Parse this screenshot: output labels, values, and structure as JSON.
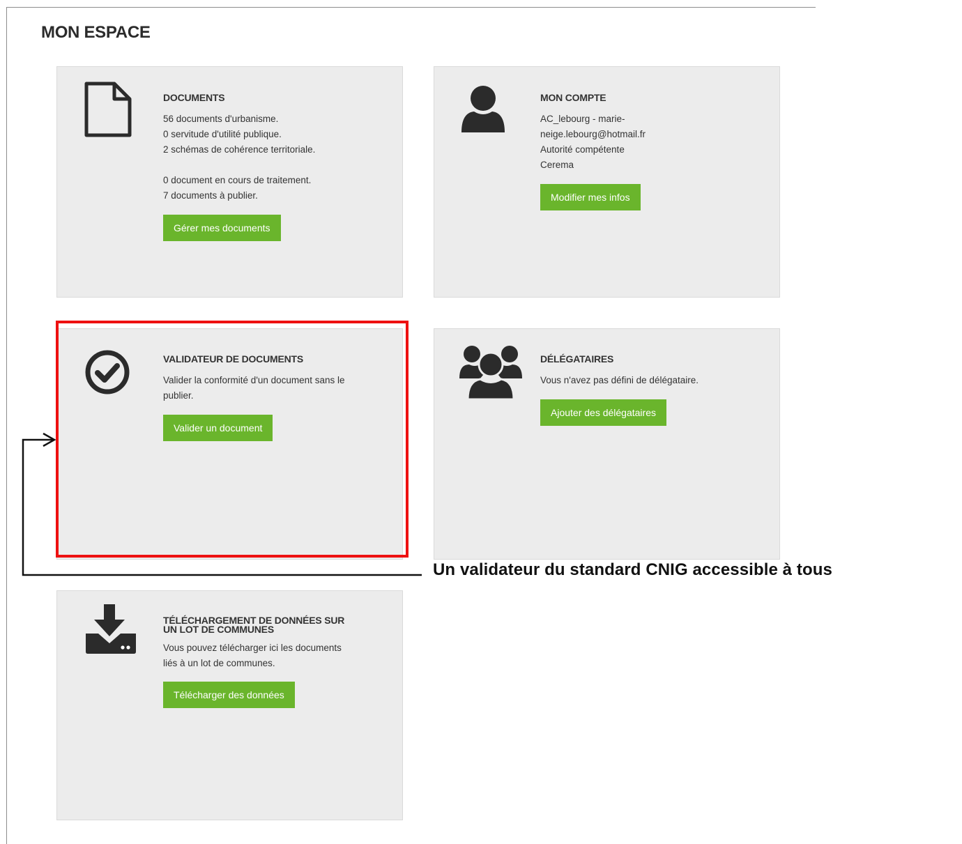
{
  "page": {
    "title": "MON ESPACE"
  },
  "cards": {
    "documents": {
      "title": "DOCUMENTS",
      "lines": [
        "56 documents d'urbanisme.",
        "0 servitude d'utilité publique.",
        "2 schémas de cohérence territoriale.",
        "",
        "0 document en cours de traitement.",
        "7 documents à publier."
      ],
      "button": "Gérer mes documents",
      "icon": "document-icon"
    },
    "account": {
      "title": "MON COMPTE",
      "lines": [
        "AC_lebourg - marie-",
        "neige.lebourg@hotmail.fr",
        "Autorité compétente",
        "Cerema"
      ],
      "button": "Modifier mes infos",
      "icon": "user-icon"
    },
    "validator": {
      "title": "VALIDATEUR DE DOCUMENTS",
      "lines": [
        "Valider la conformité d'un document sans le",
        "publier."
      ],
      "button": "Valider un document",
      "icon": "check-circle-icon"
    },
    "delegates": {
      "title": "DÉLÉGATAIRES",
      "lines": [
        "Vous n'avez pas défini de délégataire."
      ],
      "button": "Ajouter des délégataires",
      "icon": "users-group-icon"
    },
    "download": {
      "title_line1": "TÉLÉCHARGEMENT DE DONNÉES SUR",
      "title_line2": "UN LOT DE COMMUNES",
      "lines": [
        "Vous pouvez télécharger ici les documents",
        "liés à un lot de communes."
      ],
      "button": "Télécharger des données",
      "icon": "download-icon"
    }
  },
  "annotation": {
    "text": "Un validateur du standard CNIG accessible à tous",
    "highlight_color": "#ee1111"
  },
  "colors": {
    "button": "#6ab52c",
    "card": "#ececec",
    "icon": "#2b2b2b"
  }
}
